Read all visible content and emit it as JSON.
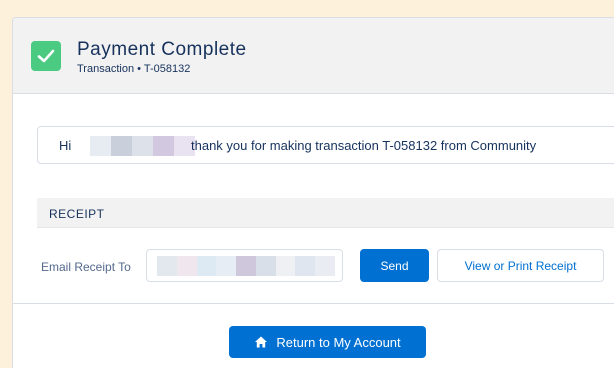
{
  "header": {
    "title": "Payment Complete",
    "subtitle": "Transaction • T-058132",
    "status_icon": "success-check-icon",
    "accent_color": "#4bca81"
  },
  "message": {
    "greeting": "Hi",
    "redacted_name_colors": [
      "#e7ecf3",
      "#c9d0dc",
      "#dde2ea",
      "#d2c8df",
      "#e9e2f1"
    ],
    "text": "thank you for making transaction T-058132 from Community"
  },
  "receipt": {
    "section_title": "RECEIPT",
    "email_label": "Email Receipt To",
    "email_value_redacted_colors": [
      "#e3e7ee",
      "#f0e6ee",
      "#dde9f3",
      "#e7edf5",
      "#cfc8dc",
      "#d9dfe9",
      "#eef0f4",
      "#dfe6ef",
      "#e9ecf2"
    ],
    "send_label": "Send",
    "print_label": "View or Print Receipt"
  },
  "footer": {
    "return_label": "Return to My Account",
    "return_icon": "home-icon",
    "button_color": "#0070d2"
  }
}
